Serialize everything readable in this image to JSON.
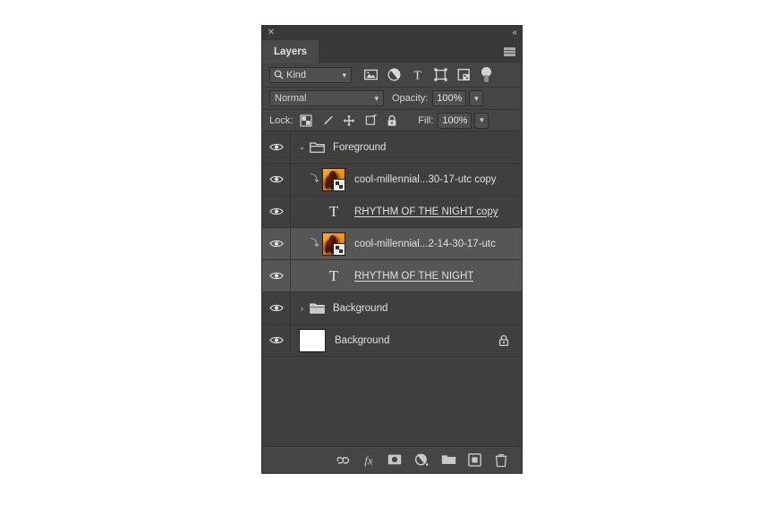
{
  "panel": {
    "title_bar": {
      "close_label": "✕",
      "collapse_label": "«"
    },
    "tab_label": "Layers",
    "menu_icon": "panel-menu-icon"
  },
  "filter": {
    "kind_label": "Kind",
    "search_icon": "search-icon",
    "icons": [
      {
        "name": "filter-pixel-layers-icon",
        "title": "Pixel Layers"
      },
      {
        "name": "filter-adjustment-layers-icon",
        "title": "Adjustment Layers"
      },
      {
        "name": "filter-type-layers-icon",
        "title": "Type Layers"
      },
      {
        "name": "filter-shape-layers-icon",
        "title": "Shape Layers"
      },
      {
        "name": "filter-smart-objects-icon",
        "title": "Smart Objects"
      }
    ],
    "toggle_name": "filter-enable-toggle"
  },
  "blend": {
    "mode": "Normal",
    "opacity_label": "Opacity:",
    "opacity_value": "100%",
    "caret": "⌄"
  },
  "lock": {
    "label": "Lock:",
    "icons": [
      {
        "name": "lock-transparent-pixels-icon"
      },
      {
        "name": "lock-image-pixels-icon"
      },
      {
        "name": "lock-position-icon"
      },
      {
        "name": "lock-artboard-nesting-icon"
      },
      {
        "name": "lock-all-icon"
      }
    ],
    "fill_label": "Fill:",
    "fill_value": "100%"
  },
  "layers": [
    {
      "type": "group",
      "name": "Foreground",
      "expanded": true,
      "disclosure": "⌄",
      "selected": false,
      "visible": true,
      "locked": false
    },
    {
      "type": "smart-object",
      "name": "cool-millennial...30-17-utc copy",
      "clipped": true,
      "clip_glyph": "⤵",
      "selected": false,
      "visible": true,
      "locked": false
    },
    {
      "type": "text",
      "name": "RHYTHM OF THE NIGHT copy",
      "icon_glyph": "T",
      "selected": false,
      "visible": true,
      "locked": false
    },
    {
      "type": "smart-object",
      "name": "cool-millennial...2-14-30-17-utc",
      "clipped": true,
      "clip_glyph": "⤵",
      "selected": true,
      "visible": true,
      "locked": false
    },
    {
      "type": "text",
      "name": "RHYTHM OF THE NIGHT",
      "icon_glyph": "T",
      "selected": true,
      "visible": true,
      "locked": false
    },
    {
      "type": "group",
      "name": "Background",
      "expanded": false,
      "disclosure": "›",
      "selected": false,
      "visible": true,
      "locked": false
    },
    {
      "type": "background",
      "name": "Background",
      "selected": false,
      "visible": true,
      "locked": true
    }
  ],
  "bottom_toolbar": [
    {
      "name": "link-layers-icon",
      "label": "Link layers"
    },
    {
      "name": "layer-style-fx-icon",
      "label": "fx"
    },
    {
      "name": "add-layer-mask-icon",
      "label": "Add layer mask"
    },
    {
      "name": "new-adjustment-layer-icon",
      "label": "New adjustment layer"
    },
    {
      "name": "new-group-icon",
      "label": "New group"
    },
    {
      "name": "new-layer-icon",
      "label": "New layer"
    },
    {
      "name": "delete-layer-icon",
      "label": "Delete layer"
    }
  ],
  "colors": {
    "page_background": "#ffffff",
    "panel_background": "#3f3f3f",
    "chrome_background": "#454545",
    "tab_active": "#4a4a4a",
    "row_selected": "#565656",
    "text": "#e0e0e0",
    "thumb_accent": "#f59a14"
  }
}
